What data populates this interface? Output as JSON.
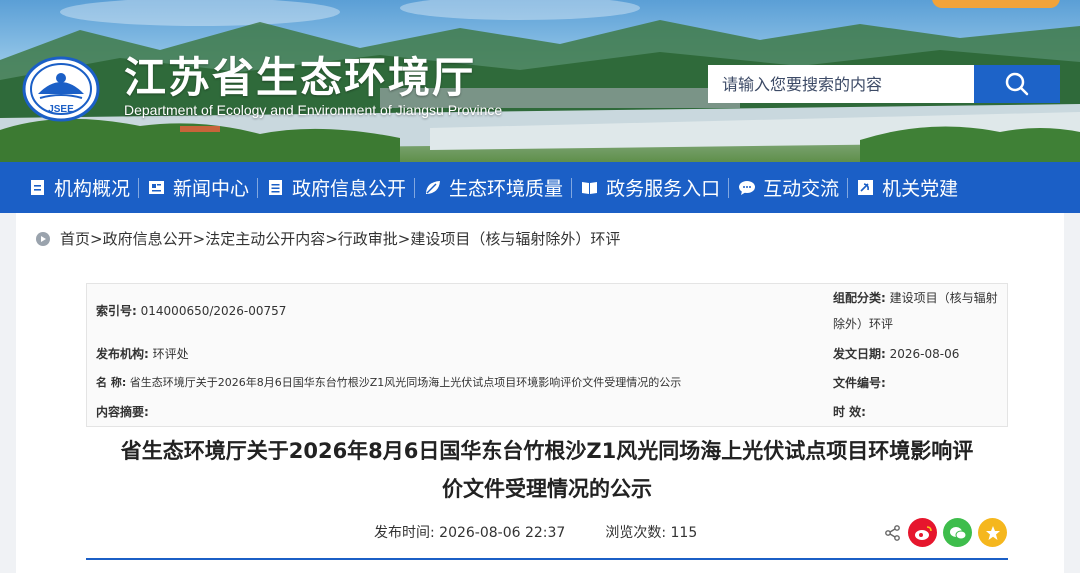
{
  "header": {
    "title": "江苏省生态环境厅",
    "subtitle": "Department of Ecology and Environment of Jiangsu Province",
    "logo_text": "JSEE",
    "search_placeholder": "请输入您要搜索的内容"
  },
  "nav": {
    "items": [
      {
        "label": "机构概况",
        "icon": "document-icon"
      },
      {
        "label": "新闻中心",
        "icon": "newspaper-icon"
      },
      {
        "label": "政府信息公开",
        "icon": "list-icon"
      },
      {
        "label": "生态环境质量",
        "icon": "leaf-icon"
      },
      {
        "label": "政务服务入口",
        "icon": "book-icon"
      },
      {
        "label": "互动交流",
        "icon": "chat-icon"
      },
      {
        "label": "机关党建",
        "icon": "party-emblem-icon"
      }
    ]
  },
  "breadcrumb": {
    "items": [
      "首页",
      "政府信息公开",
      "法定主动公开内容",
      "行政审批",
      "建设项目（核与辐射除外）环评"
    ],
    "separator": ">"
  },
  "meta": {
    "index_label": "索引号:",
    "index_value": "014000650/2026-00757",
    "category_label": "组配分类:",
    "category_value_1": "建设项目（核与辐射",
    "category_value_2": "除外）环评",
    "org_label": "发布机构:",
    "org_value": "环评处",
    "date_label": "发文日期:",
    "date_value": "2026-08-06",
    "name_label": "名 称:",
    "name_value": "省生态环境厅关于2026年8月6日国华东台竹根沙Z1风光同场海上光伏试点项目环境影响评价文件受理情况的公示",
    "docno_label": "文件编号:",
    "docno_value": "",
    "summary_label": "内容摘要:",
    "summary_value": "",
    "validity_label": "时 效:",
    "validity_value": ""
  },
  "article": {
    "title_line1": "省生态环境厅关于2026年8月6日国华东台竹根沙Z1风光同场海上光伏试点项目环境影响评",
    "title_line2": "价文件受理情况的公示",
    "published_label": "发布时间:",
    "published_value": "2026-08-06 22:37",
    "views_label": "浏览次数:",
    "views_value": "115"
  },
  "share": {
    "icons": [
      "share-icon",
      "weibo-icon",
      "wechat-icon",
      "favorite-icon"
    ]
  },
  "colors": {
    "nav_bg": "#1b5fc6",
    "search_btn": "#1d63c8",
    "weibo": "#e6162d",
    "wechat": "#3ebd4c",
    "favorite": "#f5b71e"
  }
}
